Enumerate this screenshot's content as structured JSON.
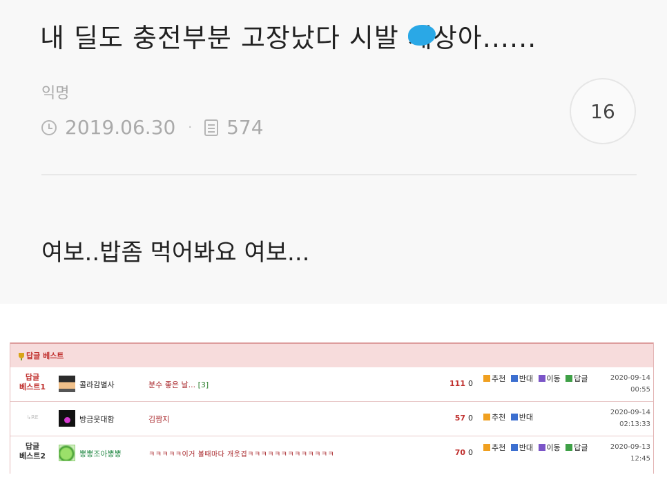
{
  "post": {
    "title": "내 딜도 충전부분 고장났다 시발 세상아......",
    "author": "익명",
    "date": "2019.06.30",
    "views": "574",
    "comment_count": "16",
    "body": "여보..밥좀 먹어봐요 여보...",
    "colors": {
      "background": "#f8f8f8",
      "blot": "#2aa8e6"
    }
  },
  "board": {
    "title": "답글 베스트",
    "colors": {
      "header_bg": "#f7dcdc",
      "accent_red": "#c0302e"
    },
    "rows": [
      {
        "rank_line1": "답글",
        "rank_line2": "베스트1",
        "nickname": "콜라감별사",
        "subject": "분수 좋은 날...",
        "comment_count": "[3]",
        "score": "111",
        "zero": "0",
        "actions": [
          "추천",
          "반대",
          "이동",
          "답글"
        ],
        "date": "2020-09-14",
        "time": "00:55"
      },
      {
        "rank_line1": "↳RE",
        "rank_line2": "",
        "nickname": "방금웃대함",
        "subject": "김짬지",
        "comment_count": "",
        "score": "57",
        "zero": "0",
        "actions": [
          "추천",
          "반대"
        ],
        "date": "2020-09-14",
        "time": "02:13:33"
      },
      {
        "rank_line1": "답글",
        "rank_line2": "베스트2",
        "nickname": "뽕뽕조아뽕뽕",
        "subject": "ㅋㅋㅋㅋㅋ이거 볼때마다 개웃겹ㅋㅋㅋㅋㅋㅋㅋㅋㅋㅋㅋㅋㅋ",
        "comment_count": "",
        "score": "70",
        "zero": "0",
        "actions": [
          "추천",
          "반대",
          "이동",
          "답글"
        ],
        "date": "2020-09-13",
        "time": "12:45"
      }
    ]
  }
}
